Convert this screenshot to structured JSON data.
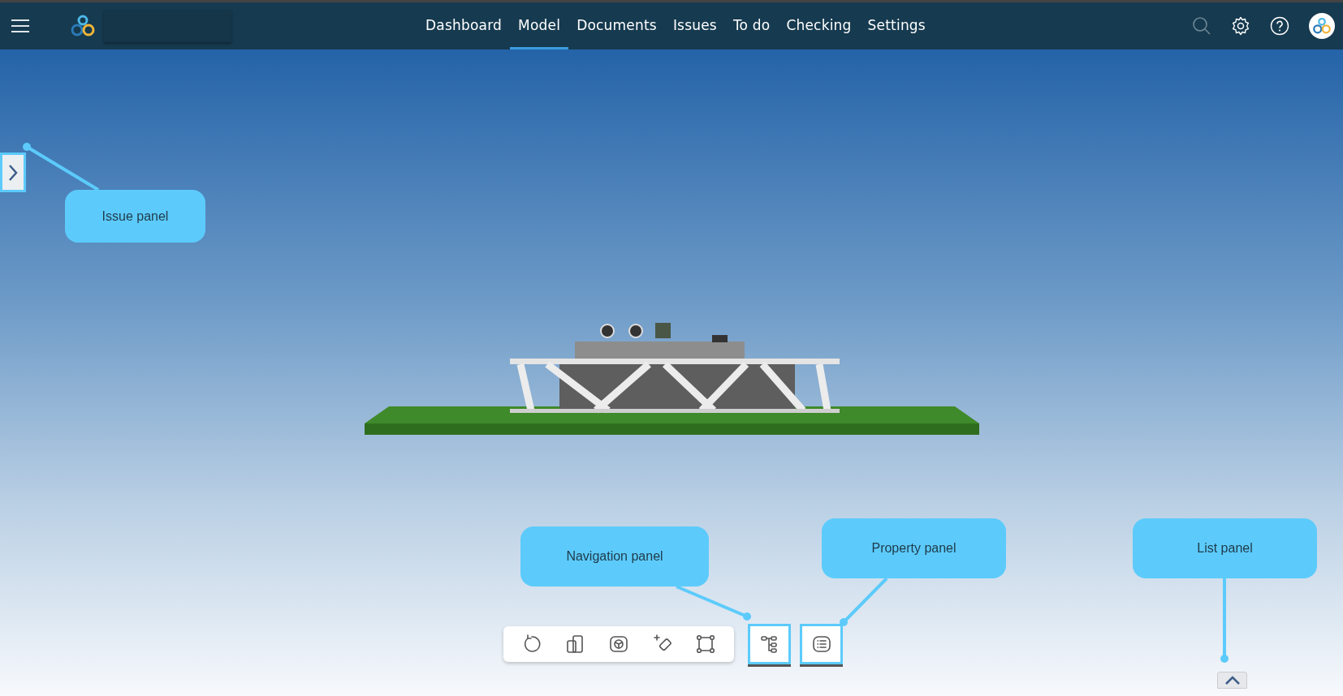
{
  "nav": [
    {
      "label": "Dashboard",
      "selected": false
    },
    {
      "label": "Model",
      "selected": true
    },
    {
      "label": "Documents",
      "selected": false
    },
    {
      "label": "Issues",
      "selected": false
    },
    {
      "label": "To do",
      "selected": false
    },
    {
      "label": "Checking",
      "selected": false
    },
    {
      "label": "Settings",
      "selected": false
    }
  ],
  "issue_panel": {
    "expanded": false
  },
  "list_panel": {
    "expanded": false
  },
  "callouts": [
    {
      "label": "Issue panel"
    },
    {
      "label": "Navigation panel"
    },
    {
      "label": "Property panel"
    },
    {
      "label": "List panel"
    }
  ]
}
